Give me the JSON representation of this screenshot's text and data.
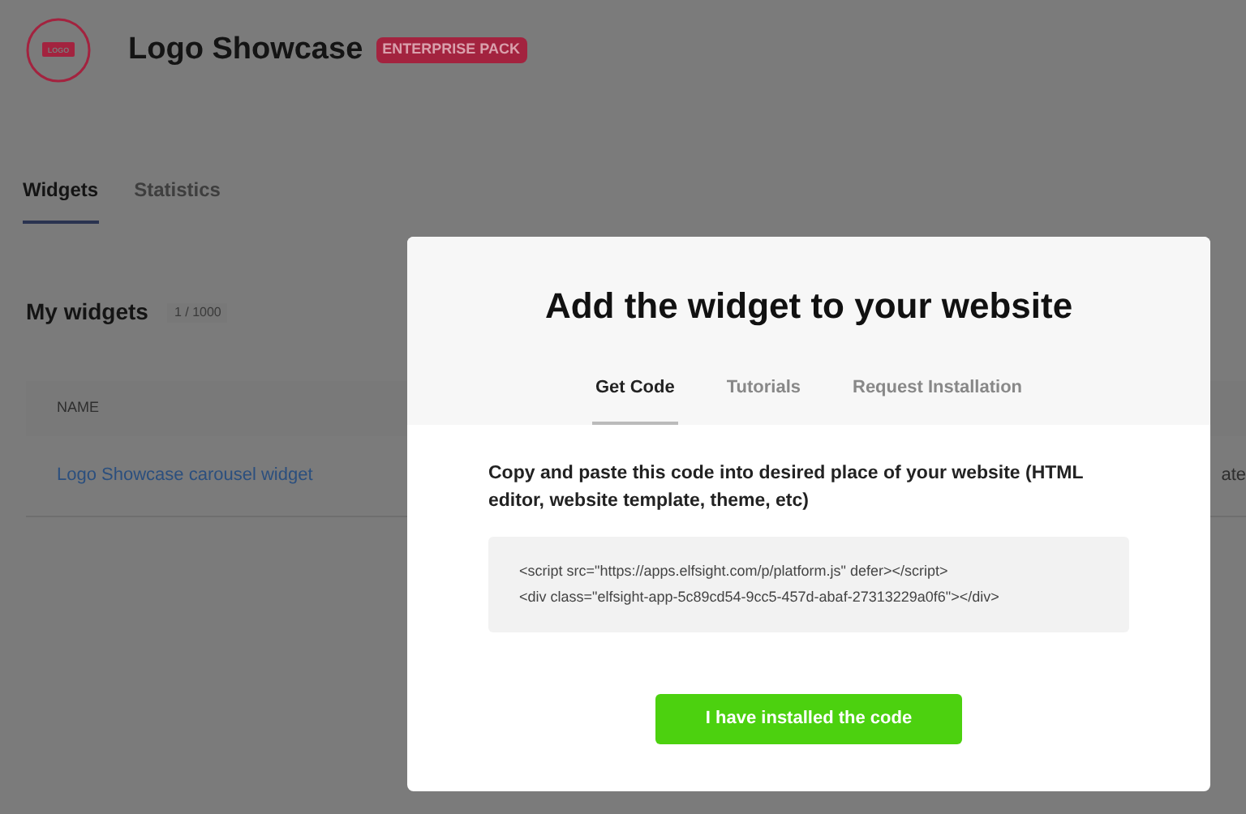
{
  "header": {
    "logo_text": "LOGO",
    "title": "Logo Showcase",
    "badge": "ENTERPRISE PACK"
  },
  "tabs": [
    {
      "label": "Widgets",
      "selected": true
    },
    {
      "label": "Statistics",
      "selected": false
    }
  ],
  "widgets": {
    "title": "My widgets",
    "count": "1 / 1000",
    "columns": [
      "NAME"
    ],
    "rows": [
      {
        "name": "Logo Showcase carousel widget",
        "column_2": "ate"
      }
    ]
  },
  "modal": {
    "title": "Add the widget to your website",
    "tabs": [
      {
        "label": "Get Code",
        "selected": true
      },
      {
        "label": "Tutorials",
        "selected": false
      },
      {
        "label": "Request Installation",
        "selected": false
      }
    ],
    "instructions": "Copy and paste this code into desired place of your website (HTML editor, website template, theme, etc)",
    "code_lines": [
      "<script src=\"https://apps.elfsight.com/p/platform.js\" defer></script>",
      "<div class=\"elfsight-app-5c89cd54-9cc5-457d-abaf-27313229a0f6\"></div>"
    ],
    "button": "I have installed the code"
  }
}
